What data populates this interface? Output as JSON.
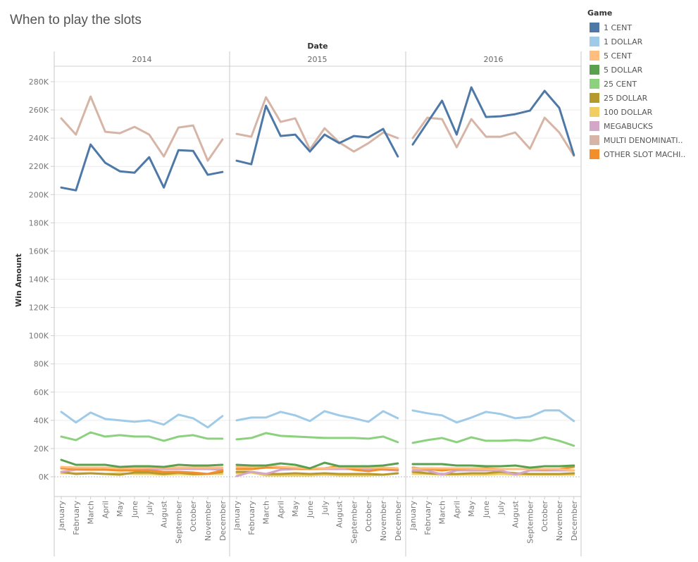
{
  "page": {
    "title": "When to play the slots"
  },
  "legend": {
    "title": "Game",
    "items": [
      {
        "label": "1 CENT",
        "color": "#4e79a7"
      },
      {
        "label": "1 DOLLAR",
        "color": "#a0cbe8"
      },
      {
        "label": "5 CENT",
        "color": "#ffbe7d"
      },
      {
        "label": "5 DOLLAR",
        "color": "#59a14f"
      },
      {
        "label": "25 CENT",
        "color": "#8cd17d"
      },
      {
        "label": "25 DOLLAR",
        "color": "#b6992d"
      },
      {
        "label": "100 DOLLAR",
        "color": "#f1ce63"
      },
      {
        "label": "MEGABUCKS",
        "color": "#d4a6c8"
      },
      {
        "label": "MULTI DENOMINATI..",
        "color": "#d7b5a6"
      },
      {
        "label": "OTHER SLOT MACHI..",
        "color": "#f28e2b"
      }
    ]
  },
  "chart_data": {
    "type": "line",
    "title": "When to play the slots",
    "xlabel": "Date",
    "ylabel": "Win Amount",
    "ylim": [
      -15000,
      290000
    ],
    "yticks": [
      0,
      20000,
      40000,
      60000,
      80000,
      100000,
      120000,
      140000,
      160000,
      180000,
      200000,
      220000,
      240000,
      260000,
      280000
    ],
    "ytick_labels": [
      "0K",
      "20K",
      "40K",
      "60K",
      "80K",
      "100K",
      "120K",
      "140K",
      "160K",
      "180K",
      "200K",
      "220K",
      "240K",
      "260K",
      "280K"
    ],
    "grid": true,
    "legend_position": "right",
    "panels": [
      "2014",
      "2015",
      "2016"
    ],
    "categories": [
      "January",
      "February",
      "March",
      "April",
      "May",
      "June",
      "July",
      "August",
      "September",
      "October",
      "November",
      "December"
    ],
    "series": [
      {
        "name": "1 CENT",
        "color": "#4e79a7",
        "values": {
          "2014": [
            205000,
            203000,
            235500,
            222500,
            216500,
            215500,
            226500,
            205000,
            231500,
            231000,
            214000,
            216000
          ],
          "2015": [
            224000,
            221500,
            263000,
            241500,
            242500,
            230500,
            242500,
            236500,
            241500,
            240500,
            246500,
            227000
          ],
          "2016": [
            235500,
            251000,
            266500,
            242500,
            276000,
            255000,
            255500,
            257000,
            259500,
            273500,
            261500,
            228000
          ]
        }
      },
      {
        "name": "1 DOLLAR",
        "color": "#a0cbe8",
        "values": {
          "2014": [
            46000,
            38500,
            45500,
            41000,
            40000,
            39000,
            40000,
            37000,
            44000,
            41500,
            35000,
            43000
          ],
          "2015": [
            40000,
            42000,
            42000,
            46000,
            43500,
            39500,
            46500,
            43500,
            41500,
            39000,
            46500,
            41500
          ],
          "2016": [
            47000,
            45000,
            43500,
            38500,
            42000,
            46000,
            44500,
            41500,
            42500,
            47000,
            47000,
            39500
          ]
        }
      },
      {
        "name": "5 CENT",
        "color": "#ffbe7d",
        "values": {
          "2014": [
            7000,
            6500,
            6500,
            6500,
            6000,
            6000,
            6500,
            6500,
            6500,
            6500,
            6500,
            6500
          ],
          "2015": [
            7000,
            7000,
            8000,
            7000,
            6500,
            6000,
            6000,
            6500,
            6500,
            6500,
            6500,
            6000
          ],
          "2016": [
            6000,
            6000,
            6000,
            6000,
            6000,
            5500,
            5500,
            5500,
            5500,
            5500,
            5500,
            4500
          ]
        }
      },
      {
        "name": "5 DOLLAR",
        "color": "#59a14f",
        "values": {
          "2014": [
            12000,
            8500,
            8500,
            8500,
            7000,
            7500,
            7500,
            7000,
            8500,
            8000,
            8000,
            8500
          ],
          "2015": [
            8500,
            8000,
            8000,
            9500,
            8500,
            6000,
            10000,
            7500,
            7500,
            7500,
            8000,
            9500
          ],
          "2016": [
            9000,
            9000,
            9000,
            8000,
            8000,
            7500,
            7500,
            8000,
            6500,
            7500,
            7500,
            8000
          ]
        }
      },
      {
        "name": "25 CENT",
        "color": "#8cd17d",
        "values": {
          "2014": [
            28500,
            26000,
            31500,
            28500,
            29500,
            28500,
            28500,
            25500,
            28500,
            29500,
            27000,
            27000
          ],
          "2015": [
            26500,
            27500,
            31000,
            29000,
            28500,
            28000,
            27500,
            27500,
            27500,
            27000,
            28500,
            24500
          ],
          "2016": [
            24000,
            26000,
            27500,
            24500,
            28000,
            25500,
            25500,
            26000,
            25500,
            28000,
            25500,
            22000
          ]
        }
      },
      {
        "name": "25 DOLLAR",
        "color": "#b6992d",
        "values": {
          "2014": [
            3500,
            2000,
            2500,
            2000,
            1500,
            3000,
            3000,
            2000,
            3000,
            2000,
            2000,
            3500
          ],
          "2015": [
            3500,
            3500,
            2000,
            2000,
            2500,
            2000,
            2500,
            2000,
            2000,
            2000,
            1500,
            2500
          ],
          "2016": [
            3500,
            2500,
            2000,
            2000,
            2500,
            2500,
            3500,
            2500,
            2000,
            2000,
            2000,
            2500
          ]
        }
      },
      {
        "name": "100 DOLLAR",
        "color": "#f1ce63",
        "values": {
          "2014": [
            2500,
            2500,
            2500,
            2000,
            2500,
            2000,
            2000,
            1500,
            2000,
            1500,
            2000,
            2000
          ],
          "2015": [
            2500,
            3000,
            1000,
            1000,
            1000,
            1000,
            1500,
            1000,
            1000,
            1000,
            1500,
            2500
          ],
          "2016": [
            2000,
            2000,
            1500,
            1500,
            1500,
            1500,
            2000,
            1500,
            1500,
            1500,
            1500,
            1500
          ]
        }
      },
      {
        "name": "MEGABUCKS",
        "color": "#d4a6c8",
        "values": {
          "2014": [
            3500,
            5000,
            5000,
            5000,
            5000,
            5500,
            5500,
            5500,
            5500,
            5500,
            5500,
            5000
          ],
          "2015": [
            500,
            3500,
            2000,
            5000,
            5500,
            5500,
            5500,
            5500,
            5500,
            5500,
            5000,
            4500
          ],
          "2016": [
            4500,
            4500,
            1500,
            4500,
            4500,
            4500,
            4500,
            1500,
            4500,
            4500,
            4500,
            4500
          ]
        }
      },
      {
        "name": "MULTI DENOMINATION",
        "color": "#d7b5a6",
        "values": {
          "2014": [
            254000,
            242500,
            269500,
            244500,
            243500,
            248000,
            242500,
            227000,
            247500,
            249000,
            224000,
            239000
          ],
          "2015": [
            243000,
            241000,
            269000,
            251500,
            254000,
            232000,
            247000,
            237000,
            230500,
            236500,
            244000,
            240000
          ],
          "2016": [
            240000,
            254500,
            253500,
            233500,
            253500,
            241000,
            241000,
            244000,
            232500,
            254500,
            244000,
            227500
          ]
        }
      },
      {
        "name": "OTHER SLOT MACHINES",
        "color": "#f28e2b",
        "values": {
          "2014": [
            6000,
            5500,
            5000,
            5000,
            4500,
            4500,
            4500,
            3500,
            3500,
            3000,
            2000,
            4500
          ],
          "2015": [
            5500,
            5500,
            6500,
            6500,
            6000,
            5500,
            6000,
            7500,
            5000,
            4000,
            5500,
            5000
          ],
          "2016": [
            6500,
            5500,
            4500,
            5500,
            6000,
            6000,
            5500,
            5500,
            5500,
            5000,
            5500,
            7000
          ]
        }
      }
    ]
  }
}
